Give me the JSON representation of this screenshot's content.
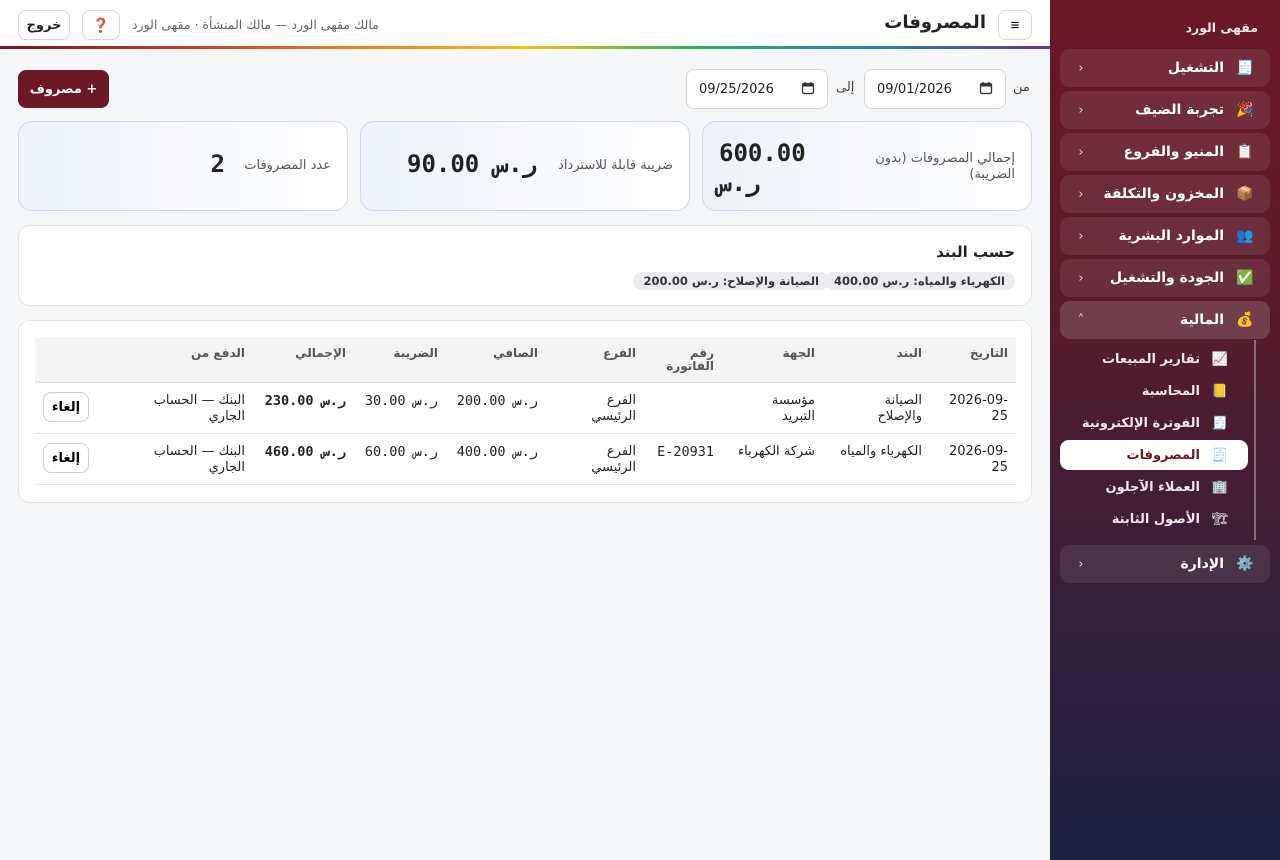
{
  "app": {
    "brand": "مقهى الورد"
  },
  "header": {
    "title": "المصروفات",
    "user_line": "مالك مقهى الورد — مالك المنشأة · مقهى الورد",
    "help_icon": "❓",
    "logout": "خروج",
    "menu_icon": "≡"
  },
  "sidebar": {
    "groups": [
      {
        "icon": "🧾",
        "label": "التشغيل",
        "chevron": "‹"
      },
      {
        "icon": "🎉",
        "label": "تجربة الضيف",
        "chevron": "‹"
      },
      {
        "icon": "📋",
        "label": "المنيو والفروع",
        "chevron": "‹"
      },
      {
        "icon": "📦",
        "label": "المخزون والتكلفة",
        "chevron": "‹"
      },
      {
        "icon": "👥",
        "label": "الموارد البشرية",
        "chevron": "‹"
      },
      {
        "icon": "✅",
        "label": "الجودة والتشغيل",
        "chevron": "‹"
      },
      {
        "icon": "💰",
        "label": "المالية",
        "chevron": "˄"
      }
    ],
    "finance_items": [
      {
        "icon": "📈",
        "label": "تقارير المبيعات"
      },
      {
        "icon": "📒",
        "label": "المحاسبة"
      },
      {
        "icon": "🧾",
        "label": "الفوترة الإلكترونية"
      },
      {
        "icon": "🧾",
        "label": "المصروفات"
      },
      {
        "icon": "🏢",
        "label": "العملاء الآجلون"
      },
      {
        "icon": "🏗",
        "label": "الأصول الثابتة"
      }
    ],
    "admin": {
      "icon": "⚙️",
      "label": "الإدارة",
      "chevron": "‹"
    }
  },
  "filters": {
    "from_label": "من",
    "from_value": "09/01/2026",
    "to_label": "إلى",
    "to_value": "09/25/2026",
    "add_button": "+ مصروف"
  },
  "stats": {
    "total_label": "إجمالي المصروفات (بدون الضريبة)",
    "total_value_line1": "600.00",
    "total_value_line2": "ر.س",
    "tax_label": "ضريبة قابلة للاسترداد",
    "tax_value": "ر.س 90.00",
    "count_label": "عدد المصروفات",
    "count_value": "2"
  },
  "by_category": {
    "title": "حسب البند",
    "chips": [
      "الكهرباء والمياه: ر.س 400.00",
      "الصيانة والإصلاح: ر.س 200.00"
    ]
  },
  "table": {
    "headers": {
      "date": "التاريخ",
      "item": "البند",
      "party": "الجهة",
      "invoice_line1": "رقم",
      "invoice_line2": "الفاتورة",
      "branch": "الفرع",
      "net": "الصافي",
      "tax": "الضريبة",
      "total": "الإجمالي",
      "paid_from": "الدفع من"
    },
    "rows": [
      {
        "date_line1": "-2026-09",
        "date_line2": "25",
        "item_line1": "الصيانة",
        "item_line2": "والإصلاح",
        "party_line1": "مؤسسة",
        "party_line2": "التبريد",
        "invoice": "",
        "branch_line1": "الفرع",
        "branch_line2": "الرئيسي",
        "net": "ر.س 200.00",
        "tax": "ر.س 30.00",
        "total": "ر.س 230.00",
        "paid_line1": "البنك — الحساب",
        "paid_line2": "الجاري",
        "action": "إلغاء"
      },
      {
        "date_line1": "-2026-09",
        "date_line2": "25",
        "item_line1": "الكهرباء والمياه",
        "item_line2": "",
        "party_line1": "شركة الكهرباء",
        "party_line2": "",
        "invoice": "E-20931",
        "branch_line1": "الفرع",
        "branch_line2": "الرئيسي",
        "net": "ر.س 400.00",
        "tax": "ر.س 60.00",
        "total": "ر.س 460.00",
        "paid_line1": "البنك — الحساب",
        "paid_line2": "الجاري",
        "action": "إلغاء"
      }
    ]
  }
}
